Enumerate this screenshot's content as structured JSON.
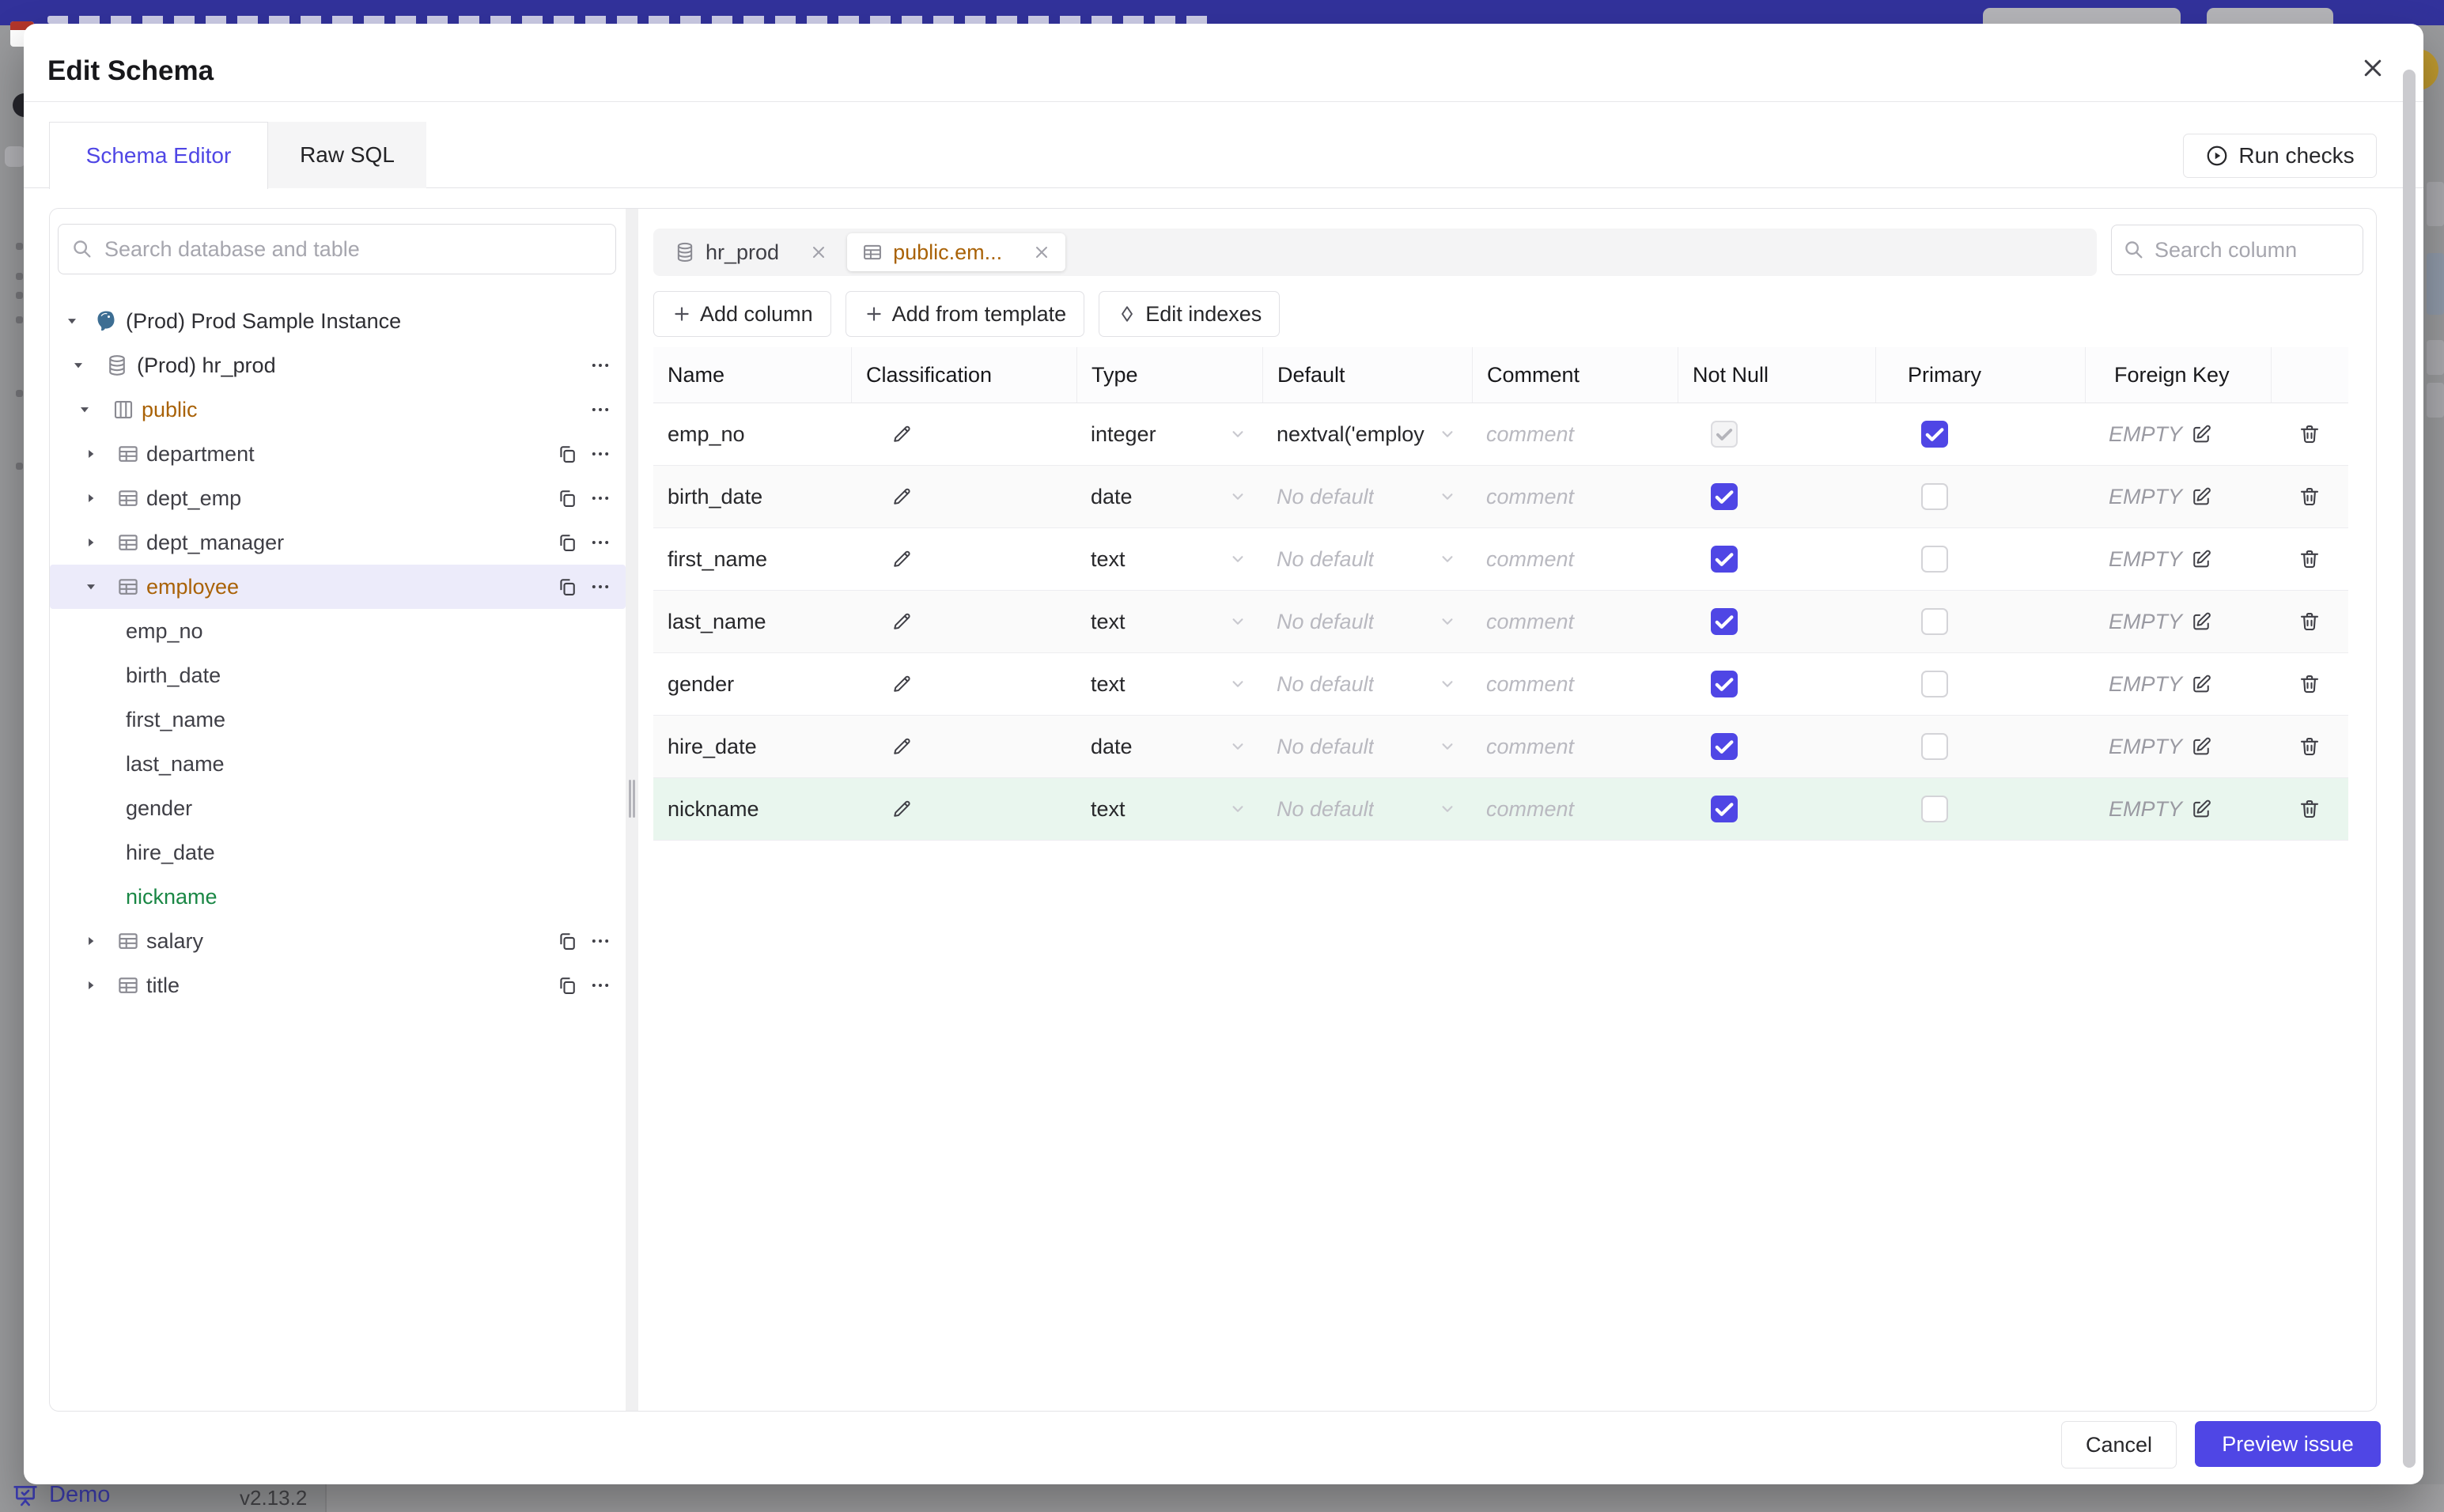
{
  "modal": {
    "title": "Edit Schema"
  },
  "tabs": [
    {
      "label": "Schema Editor",
      "active": true
    },
    {
      "label": "Raw SQL",
      "active": false
    }
  ],
  "run_checks_label": "Run checks",
  "sidebar": {
    "search_placeholder": "Search database and table",
    "tree": [
      {
        "level": 0,
        "icon": "postgres",
        "label": "(Prod) Prod Sample Instance",
        "expanded": true,
        "tone": "dark"
      },
      {
        "level": 1,
        "icon": "database",
        "label": "(Prod) hr_prod",
        "expanded": true,
        "more": true,
        "tone": "dark"
      },
      {
        "level": 2,
        "icon": "schema",
        "label": "public",
        "expanded": true,
        "more": true,
        "tone": "modified"
      },
      {
        "level": 3,
        "icon": "table",
        "label": "department",
        "expanded": false,
        "copy": true,
        "more": true
      },
      {
        "level": 3,
        "icon": "table",
        "label": "dept_emp",
        "expanded": false,
        "copy": true,
        "more": true
      },
      {
        "level": 3,
        "icon": "table",
        "label": "dept_manager",
        "expanded": false,
        "copy": true,
        "more": true
      },
      {
        "level": 3,
        "icon": "table",
        "label": "employee",
        "expanded": true,
        "copy": true,
        "more": true,
        "tone": "modified",
        "selected": true
      },
      {
        "level": 4,
        "label": "emp_no"
      },
      {
        "level": 4,
        "label": "birth_date"
      },
      {
        "level": 4,
        "label": "first_name"
      },
      {
        "level": 4,
        "label": "last_name"
      },
      {
        "level": 4,
        "label": "gender"
      },
      {
        "level": 4,
        "label": "hire_date"
      },
      {
        "level": 4,
        "label": "nickname",
        "tone": "added"
      },
      {
        "level": 3,
        "icon": "table",
        "label": "salary",
        "expanded": false,
        "copy": true,
        "more": true
      },
      {
        "level": 3,
        "icon": "table",
        "label": "title",
        "expanded": false,
        "copy": true,
        "more": true
      }
    ]
  },
  "editor": {
    "chips": [
      {
        "icon": "database",
        "label": "hr_prod",
        "active": false
      },
      {
        "icon": "table",
        "label": "public.em...",
        "active": true
      }
    ],
    "column_search_placeholder": "Search column",
    "toolbar": [
      {
        "icon": "plus",
        "label": "Add column"
      },
      {
        "icon": "plus",
        "label": "Add from template"
      },
      {
        "icon": "diamond",
        "label": "Edit indexes"
      }
    ],
    "table": {
      "headers": [
        "Name",
        "Classification",
        "Type",
        "Default",
        "Comment",
        "Not Null",
        "Primary",
        "Foreign Key",
        ""
      ],
      "comment_placeholder": "comment",
      "foreign_key_value": "EMPTY",
      "rows": [
        {
          "name": "emp_no",
          "type": "integer",
          "default": "nextval('employ",
          "default_is_placeholder": false,
          "not_null": "checked-disabled",
          "primary": true,
          "added": false
        },
        {
          "name": "birth_date",
          "type": "date",
          "default": "No default",
          "default_is_placeholder": true,
          "not_null": "checked",
          "primary": false,
          "added": false
        },
        {
          "name": "first_name",
          "type": "text",
          "default": "No default",
          "default_is_placeholder": true,
          "not_null": "checked",
          "primary": false,
          "added": false
        },
        {
          "name": "last_name",
          "type": "text",
          "default": "No default",
          "default_is_placeholder": true,
          "not_null": "checked",
          "primary": false,
          "added": false
        },
        {
          "name": "gender",
          "type": "text",
          "default": "No default",
          "default_is_placeholder": true,
          "not_null": "checked",
          "primary": false,
          "added": false
        },
        {
          "name": "hire_date",
          "type": "date",
          "default": "No default",
          "default_is_placeholder": true,
          "not_null": "checked",
          "primary": false,
          "added": false
        },
        {
          "name": "nickname",
          "type": "text",
          "default": "No default",
          "default_is_placeholder": true,
          "not_null": "checked",
          "primary": false,
          "added": true
        }
      ]
    }
  },
  "footer": {
    "cancel_label": "Cancel",
    "submit_label": "Preview issue"
  },
  "page_behind": {
    "brand": "Demo",
    "version": "v2.13.2"
  },
  "icons": {
    "search": "⌕",
    "close": "✕",
    "more": "⋯",
    "copy": "⧉",
    "plus": "+",
    "diamond": "◇",
    "caret-down": "▾",
    "caret-right": "▸",
    "pencil": "✎",
    "select-chevron": "⌄",
    "play-circle": "▶",
    "edit-square": "✎",
    "trash": "🗑",
    "checkmark": "✓",
    "postgres": "elephant-logo",
    "database": "db-cylinder",
    "schema": "columns-box",
    "table": "grid-box",
    "presentation": "demo-board",
    "calendar": "calendar"
  },
  "colors": {
    "accent": "#4f46e5",
    "modified_text": "#a96207",
    "added_text": "#1a8745",
    "added_row_bg": "#e9f6ee",
    "selected_row_bg": "#ecebfa",
    "topbar_behind": "#32329b"
  }
}
